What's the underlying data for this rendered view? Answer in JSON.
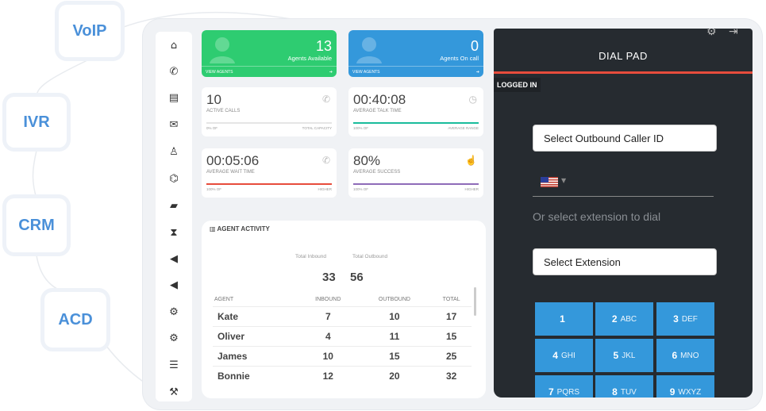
{
  "feature_tags": [
    "VoIP",
    "IVR",
    "CRM",
    "ACD"
  ],
  "sidebar": {
    "icons": [
      "home-icon",
      "phone-icon",
      "chat-icon",
      "mail-icon",
      "user-icon",
      "tag-icon",
      "folder-icon",
      "hourglass-icon",
      "megaphone-icon",
      "megaphone-icon",
      "settings-icon",
      "settings-icon",
      "list-icon",
      "wrench-icon"
    ]
  },
  "cards": {
    "agents_available": {
      "value": "13",
      "label": "Agents Available",
      "link": "VIEW AGENTS"
    },
    "agents_on_call": {
      "value": "0",
      "label": "Agents On call",
      "link": "VIEW AGENTS"
    },
    "active_calls": {
      "value": "10",
      "label": "ACTIVE CALLS",
      "foot_left": "0% OF",
      "foot_right": "TOTAL CAPACITY",
      "progress": 0.0,
      "color": "#cccccc"
    },
    "avg_talk_time": {
      "value": "00:40:08",
      "label": "AVERAGE TALK TIME",
      "foot_left": "100% OF",
      "foot_right": "AVERAGE RANGE",
      "progress": 1.0,
      "color": "#1abc9c"
    },
    "avg_wait_time": {
      "value": "00:05:06",
      "label": "AVERAGE WAIT TIME",
      "foot_left": "100% OF",
      "foot_right": "HIGHER",
      "progress": 1.0,
      "color": "#e74c3c"
    },
    "avg_success": {
      "value": "80%",
      "label": "AVERAGE SUCCESS",
      "foot_left": "100% OF",
      "foot_right": "HIGHER",
      "progress": 1.0,
      "color": "#8e6bb8"
    }
  },
  "activity": {
    "title": "AGENT ACTIVITY",
    "total_inbound_label": "Total Inbound",
    "total_outbound_label": "Total Outbound",
    "total_inbound": "33",
    "total_outbound": "56",
    "columns": [
      "AGENT",
      "INBOUND",
      "OUTBOUND",
      "TOTAL"
    ],
    "rows": [
      [
        "Kate",
        "7",
        "10",
        "17"
      ],
      [
        "Oliver",
        "4",
        "11",
        "15"
      ],
      [
        "James",
        "10",
        "15",
        "25"
      ],
      [
        "Bonnie",
        "12",
        "20",
        "32"
      ]
    ]
  },
  "dialpad": {
    "title": "DIAL PAD",
    "status": "LOGGED IN",
    "caller_id_placeholder": "Select Outbound Caller ID",
    "or_text": "Or select extension to dial",
    "extension_placeholder": "Select Extension",
    "keys": [
      {
        "num": "1",
        "letters": ""
      },
      {
        "num": "2",
        "letters": "ABC"
      },
      {
        "num": "3",
        "letters": "DEF"
      },
      {
        "num": "4",
        "letters": "GHI"
      },
      {
        "num": "5",
        "letters": "JKL"
      },
      {
        "num": "6",
        "letters": "MNO"
      },
      {
        "num": "7",
        "letters": "PQRS"
      },
      {
        "num": "8",
        "letters": "TUV"
      },
      {
        "num": "9",
        "letters": "WXYZ"
      }
    ]
  },
  "colors": {
    "accent_blue": "#3498db",
    "accent_green": "#2ecc71",
    "dialpad_bg": "#262b30",
    "tag_text": "#4a90d9"
  }
}
